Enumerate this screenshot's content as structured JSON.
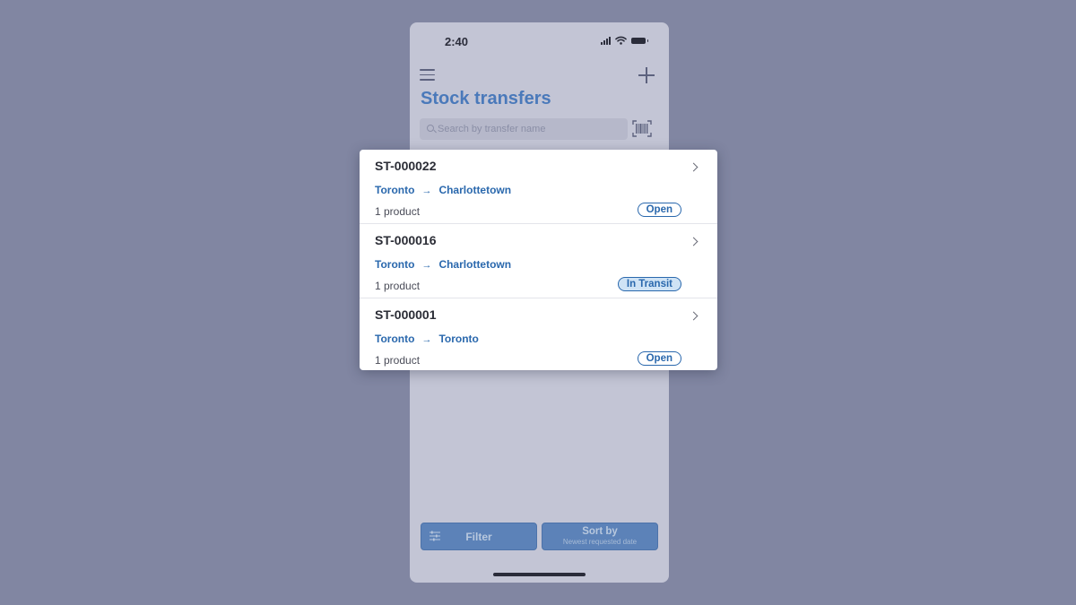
{
  "status_bar": {
    "time": "2:40"
  },
  "header": {
    "title": "Stock transfers"
  },
  "search": {
    "placeholder": "Search by transfer name"
  },
  "transfers": [
    {
      "id": "ST-000022",
      "from": "Toronto",
      "to": "Charlottetown",
      "products": "1 product",
      "status": "Open"
    },
    {
      "id": "ST-000016",
      "from": "Toronto",
      "to": "Charlottetown",
      "products": "1 product",
      "status": "In Transit"
    },
    {
      "id": "ST-000001",
      "from": "Toronto",
      "to": "Toronto",
      "products": "1 product",
      "status": "Open"
    }
  ],
  "route_arrow": "→",
  "toolbar": {
    "filter_label": "Filter",
    "sort_label": "Sort by",
    "sort_value": "Newest requested date"
  },
  "colors": {
    "background": "#8186a2",
    "accent": "#2a68ad",
    "title": "#4a79ba",
    "button": "#5c82b8"
  }
}
